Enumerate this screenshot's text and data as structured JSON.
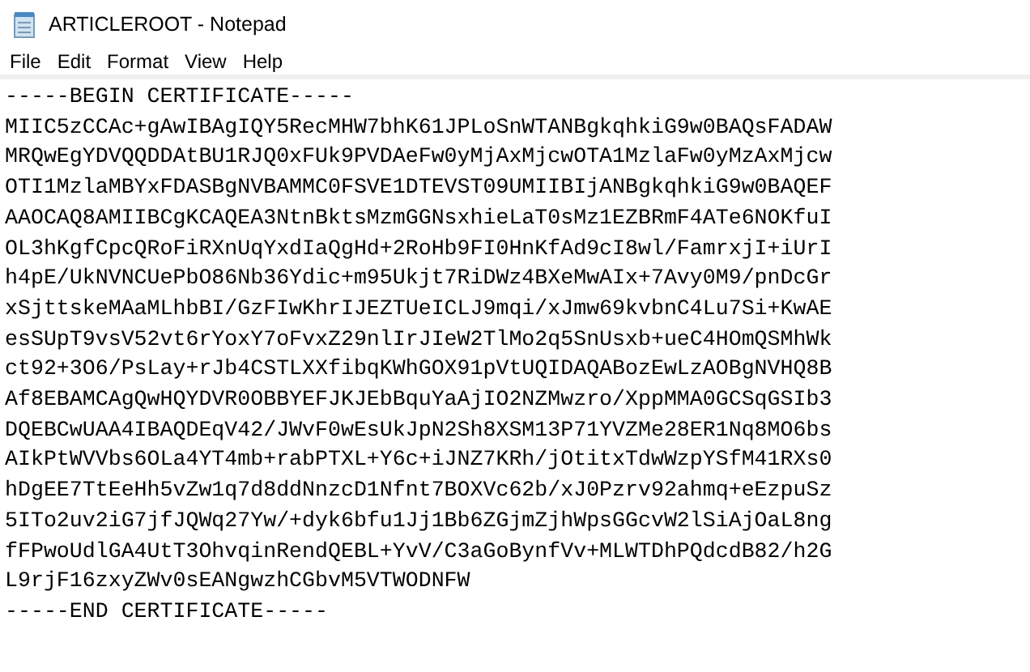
{
  "window": {
    "title": "ARTICLEROOT - Notepad"
  },
  "menu": [
    "File",
    "Edit",
    "Format",
    "View",
    "Help"
  ],
  "lines": [
    "-----BEGIN CERTIFICATE-----",
    "MIIC5zCCAc+gAwIBAgIQY5RecMHW7bhK61JPLoSnWTANBgkqhkiG9w0BAQsFADAW",
    "MRQwEgYDVQQDDAtBU1RJQ0xFUk9PVDAeFw0yMjAxMjcwOTA1MzlaFw0yMzAxMjcw",
    "OTI1MzlaMBYxFDASBgNVBAMMC0FSVE1DTEVST09UMIIBIjANBgkqhkiG9w0BAQEF",
    "AAOCAQ8AMIIBCgKCAQEA3NtnBktsMzmGGNsxhieLaT0sMz1EZBRmF4ATe6NOKfuI",
    "OL3hKgfCpcQRoFiRXnUqYxdIaQgHd+2RoHb9FI0HnKfAd9cI8wl/FamrxjI+iUrI",
    "h4pE/UkNVNCUePbO86Nb36Ydic+m95Ukjt7RiDWz4BXeMwAIx+7Avy0M9/pnDcGr",
    "xSjttskeMAaMLhbBI/GzFIwKhrIJEZTUeICLJ9mqi/xJmw69kvbnC4Lu7Si+KwAE",
    "esSUpT9vsV52vt6rYoxY7oFvxZ29nlIrJIeW2TlMo2q5SnUsxb+ueC4HOmQSMhWk",
    "ct92+3O6/PsLay+rJb4CSTLXXfibqKWhGOX91pVtUQIDAQABozEwLzAOBgNVHQ8B",
    "Af8EBAMCAgQwHQYDVR0OBBYEFJKJEbBquYaAjIO2NZMwzro/XppMMA0GCSqGSIb3",
    "DQEBCwUAA4IBAQDEqV42/JWvF0wEsUkJpN2Sh8XSM13P71YVZMe28ER1Nq8MO6bs",
    "AIkPtWVVbs6OLa4YT4mb+rabPTXL+Y6c+iJNZ7KRh/jOtitxTdwWzpYSfM41RXs0",
    "hDgEE7TtEeHh5vZw1q7d8ddNnzcD1Nfnt7BOXVc62b/xJ0Pzrv92ahmq+eEzpuSz",
    "5ITo2uv2iG7jfJQWq27Yw/+dyk6bfu1Jj1Bb6ZGjmZjhWpsGGcvW2lSiAjOaL8ng",
    "fFPwoUdlGA4UtT3OhvqinRendQEBL+YvV/C3aGoBynfVv+MLWTDhPQdcdB82/h2G",
    "L9rjF16zxyZWv0sEANgwzhCGbvM5VTWODNFW",
    "-----END CERTIFICATE-----"
  ]
}
